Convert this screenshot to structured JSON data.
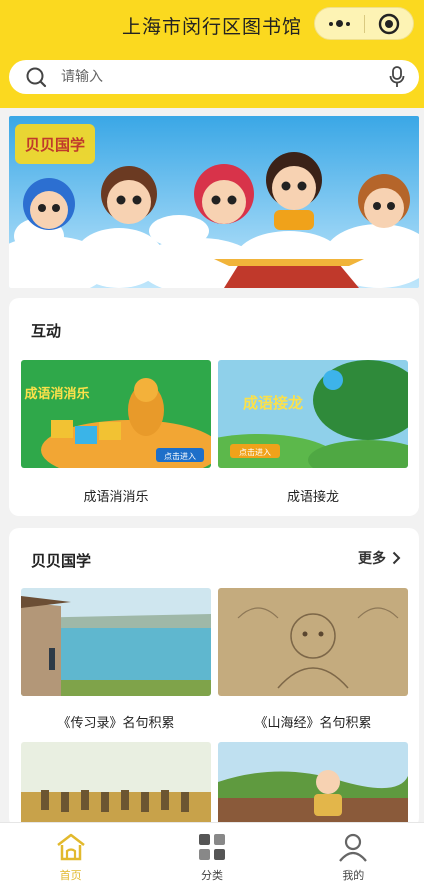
{
  "header": {
    "title": "上海市闵行区图书馆"
  },
  "search": {
    "placeholder": "请输入"
  },
  "banner": {
    "logo_text": "贝贝国学"
  },
  "interactive": {
    "title": "互动",
    "items": [
      {
        "label": "成语消消乐",
        "game_title": "成语消消乐",
        "cta": "点击进入"
      },
      {
        "label": "成语接龙",
        "game_title": "成语接龙",
        "cta": "点击进入"
      }
    ]
  },
  "guoxue": {
    "title": "贝贝国学",
    "more": "更多",
    "items": [
      {
        "label": "《传习录》名句积累"
      },
      {
        "label": "《山海经》名句积累"
      }
    ]
  },
  "tabs": [
    {
      "label": "首页",
      "icon": "home-icon",
      "active": true
    },
    {
      "label": "分类",
      "icon": "category-icon",
      "active": false
    },
    {
      "label": "我的",
      "icon": "user-icon",
      "active": false
    }
  ],
  "colors": {
    "accent": "#fbd91f",
    "active_tab": "#e2b92d"
  }
}
